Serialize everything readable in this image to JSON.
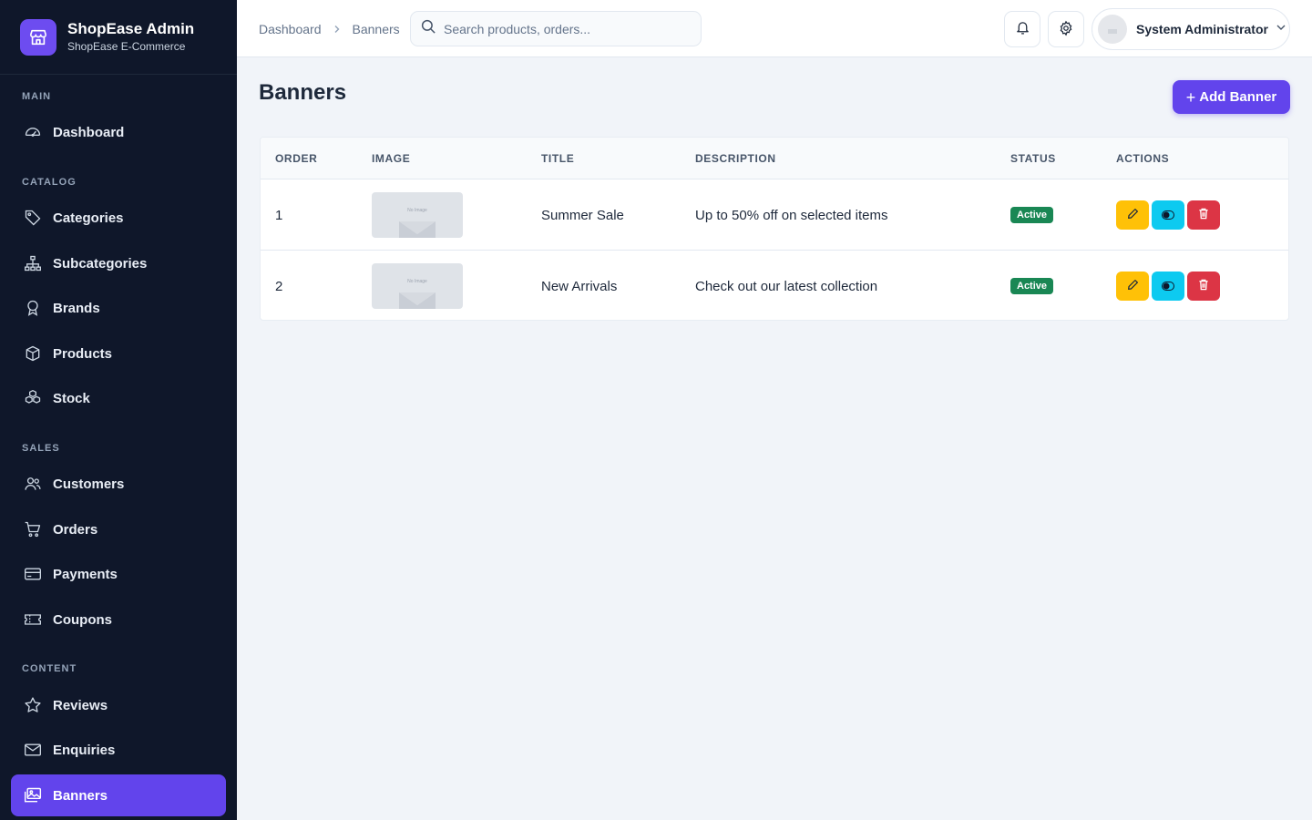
{
  "brand": {
    "title": "ShopEase Admin",
    "subtitle": "ShopEase E-Commerce",
    "logo_icon": "store-icon",
    "accent": "#6244ec"
  },
  "sidebar": {
    "sections": [
      {
        "label": "MAIN"
      },
      {
        "label": "CATALOG"
      },
      {
        "label": "SALES"
      },
      {
        "label": "CONTENT"
      }
    ],
    "items": [
      {
        "label": "Dashboard",
        "icon": "gauge-icon"
      },
      {
        "label": "Categories",
        "icon": "tag-icon"
      },
      {
        "label": "Subcategories",
        "icon": "hierarchy-icon"
      },
      {
        "label": "Brands",
        "icon": "award-icon"
      },
      {
        "label": "Products",
        "icon": "box-icon"
      },
      {
        "label": "Stock",
        "icon": "boxes-icon"
      },
      {
        "label": "Customers",
        "icon": "people-icon"
      },
      {
        "label": "Orders",
        "icon": "cart-icon"
      },
      {
        "label": "Payments",
        "icon": "credit-card-icon"
      },
      {
        "label": "Coupons",
        "icon": "ticket-icon"
      },
      {
        "label": "Reviews",
        "icon": "star-icon"
      },
      {
        "label": "Enquiries",
        "icon": "envelope-icon"
      },
      {
        "label": "Banners",
        "icon": "images-icon",
        "active": true
      }
    ]
  },
  "header": {
    "breadcrumb": [
      "Dashboard",
      "Banners"
    ],
    "search_placeholder": "Search products, orders...",
    "user_name": "System Administrator"
  },
  "main": {
    "title": "Banners",
    "add_button": "Add Banner",
    "table": {
      "columns": [
        "ORDER",
        "IMAGE",
        "TITLE",
        "DESCRIPTION",
        "STATUS",
        "ACTIONS"
      ],
      "rows": [
        {
          "order": "1",
          "image_text": "No Image",
          "title": "Summer Sale",
          "description": "Up to 50% off on selected items",
          "status": "Active"
        },
        {
          "order": "2",
          "image_text": "No Image",
          "title": "New Arrivals",
          "description": "Check out our latest collection",
          "status": "Active"
        }
      ]
    },
    "colors": {
      "status_active": "#198754",
      "edit": "#ffc107",
      "toggle": "#0dcaf0",
      "delete": "#dc3545"
    }
  }
}
